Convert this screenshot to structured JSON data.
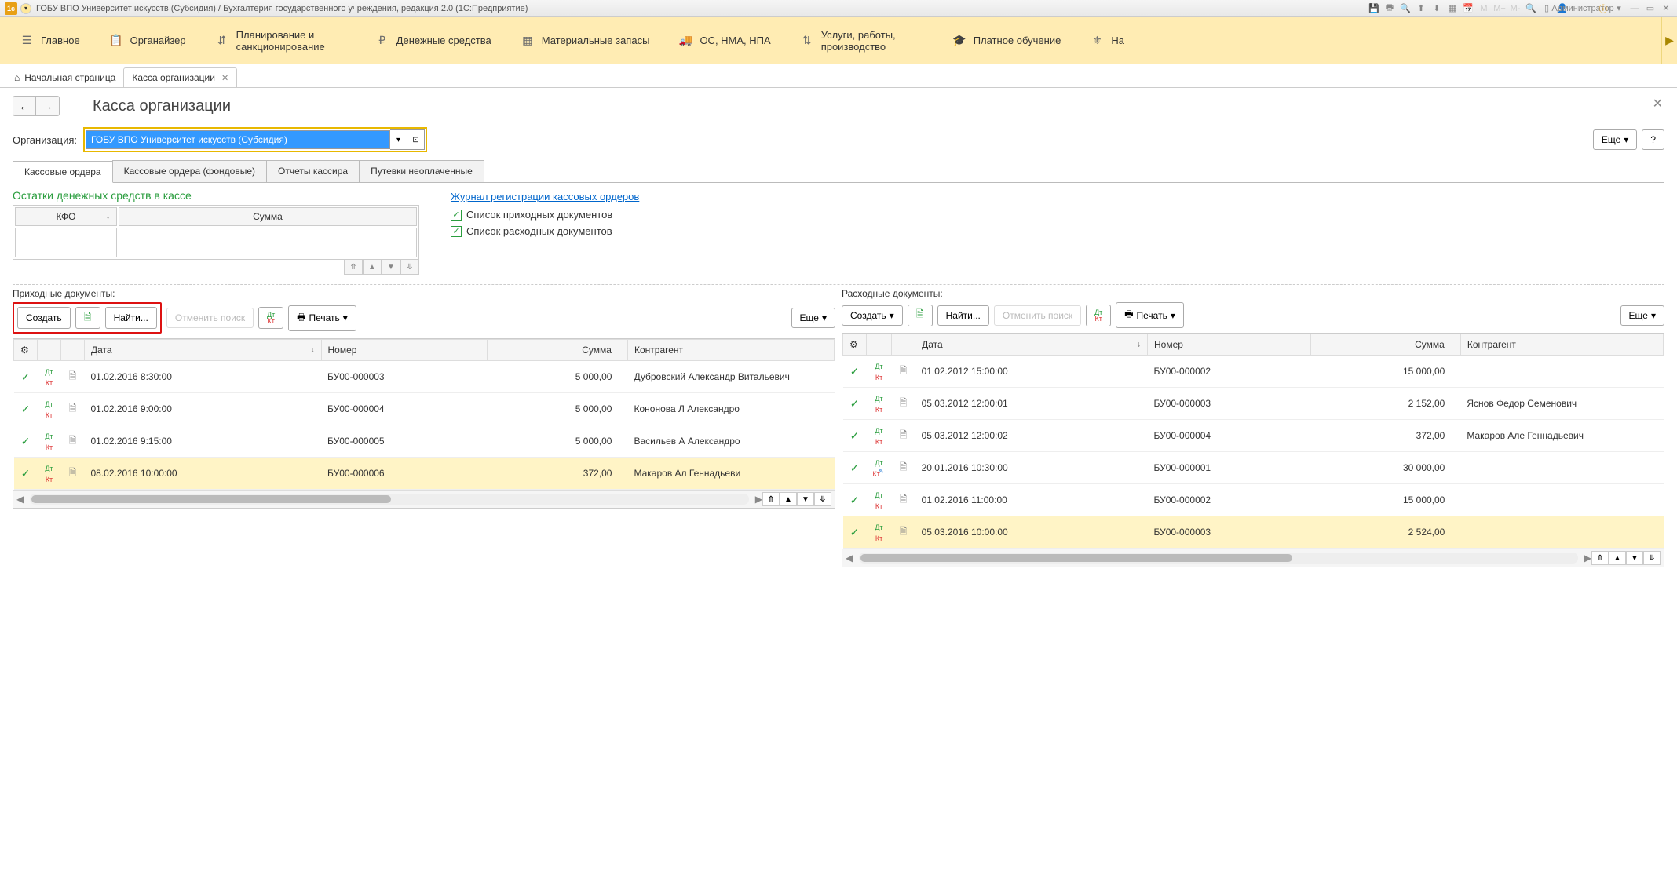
{
  "titlebar": {
    "title": "ГОБУ ВПО Университет искусств (Субсидия) / Бухгалтерия государственного учреждения, редакция 2.0  (1С:Предприятие)",
    "user": "Администратор"
  },
  "ribbon": {
    "items": [
      {
        "label": "Главное"
      },
      {
        "label": "Органайзер"
      },
      {
        "label": "Планирование и санкционирование"
      },
      {
        "label": "Денежные средства"
      },
      {
        "label": "Материальные запасы"
      },
      {
        "label": "ОС, НМА, НПА"
      },
      {
        "label": "Услуги, работы, производство"
      },
      {
        "label": "Платное обучение"
      },
      {
        "label": "На"
      }
    ]
  },
  "tabs": {
    "home": "Начальная страница",
    "active": "Касса организации"
  },
  "page": {
    "title": "Касса организации",
    "org_label": "Организация:",
    "org_value": "ГОБУ ВПО Университет искусств (Субсидия)",
    "more": "Еще",
    "help": "?"
  },
  "inner_tabs": [
    "Кассовые ордера",
    "Кассовые ордера (фондовые)",
    "Отчеты кассира",
    "Путевки неоплаченные"
  ],
  "balance": {
    "title": "Остатки денежных средств в кассе",
    "col_kfo": "КФО",
    "col_sum": "Сумма",
    "journal_link": "Журнал регистрации кассовых ордеров",
    "chk_income": "Список приходных документов",
    "chk_expense": "Список расходных документов"
  },
  "pane_income": {
    "title": "Приходные документы:",
    "create": "Создать",
    "find": "Найти...",
    "cancel_search": "Отменить поиск",
    "print": "Печать",
    "more": "Еще",
    "cols": {
      "date": "Дата",
      "number": "Номер",
      "sum": "Сумма",
      "agent": "Контрагент"
    },
    "rows": [
      {
        "date": "01.02.2016 8:30:00",
        "number": "БУ00-000003",
        "sum": "5 000,00",
        "agent": "Дубровский Александр Витальевич"
      },
      {
        "date": "01.02.2016 9:00:00",
        "number": "БУ00-000004",
        "sum": "5 000,00",
        "agent": "Кононова Л Александро"
      },
      {
        "date": "01.02.2016 9:15:00",
        "number": "БУ00-000005",
        "sum": "5 000,00",
        "agent": "Васильев А Александро"
      },
      {
        "date": "08.02.2016 10:00:00",
        "number": "БУ00-000006",
        "sum": "372,00",
        "agent": "Макаров Ал Геннадьеви"
      }
    ]
  },
  "pane_expense": {
    "title": "Расходные документы:",
    "create": "Создать",
    "find": "Найти...",
    "cancel_search": "Отменить поиск",
    "print": "Печать",
    "more": "Еще",
    "cols": {
      "date": "Дата",
      "number": "Номер",
      "sum": "Сумма",
      "agent": "Контрагент"
    },
    "rows": [
      {
        "date": "01.02.2012 15:00:00",
        "number": "БУ00-000002",
        "sum": "15 000,00",
        "agent": ""
      },
      {
        "date": "05.03.2012 12:00:01",
        "number": "БУ00-000003",
        "sum": "2 152,00",
        "agent": "Яснов Федор Семенович"
      },
      {
        "date": "05.03.2012 12:00:02",
        "number": "БУ00-000004",
        "sum": "372,00",
        "agent": "Макаров Але Геннадьевич"
      },
      {
        "date": "20.01.2016 10:30:00",
        "number": "БУ00-000001",
        "sum": "30 000,00",
        "agent": "",
        "edit": true
      },
      {
        "date": "01.02.2016 11:00:00",
        "number": "БУ00-000002",
        "sum": "15 000,00",
        "agent": ""
      },
      {
        "date": "05.03.2016 10:00:00",
        "number": "БУ00-000003",
        "sum": "2 524,00",
        "agent": ""
      }
    ]
  }
}
